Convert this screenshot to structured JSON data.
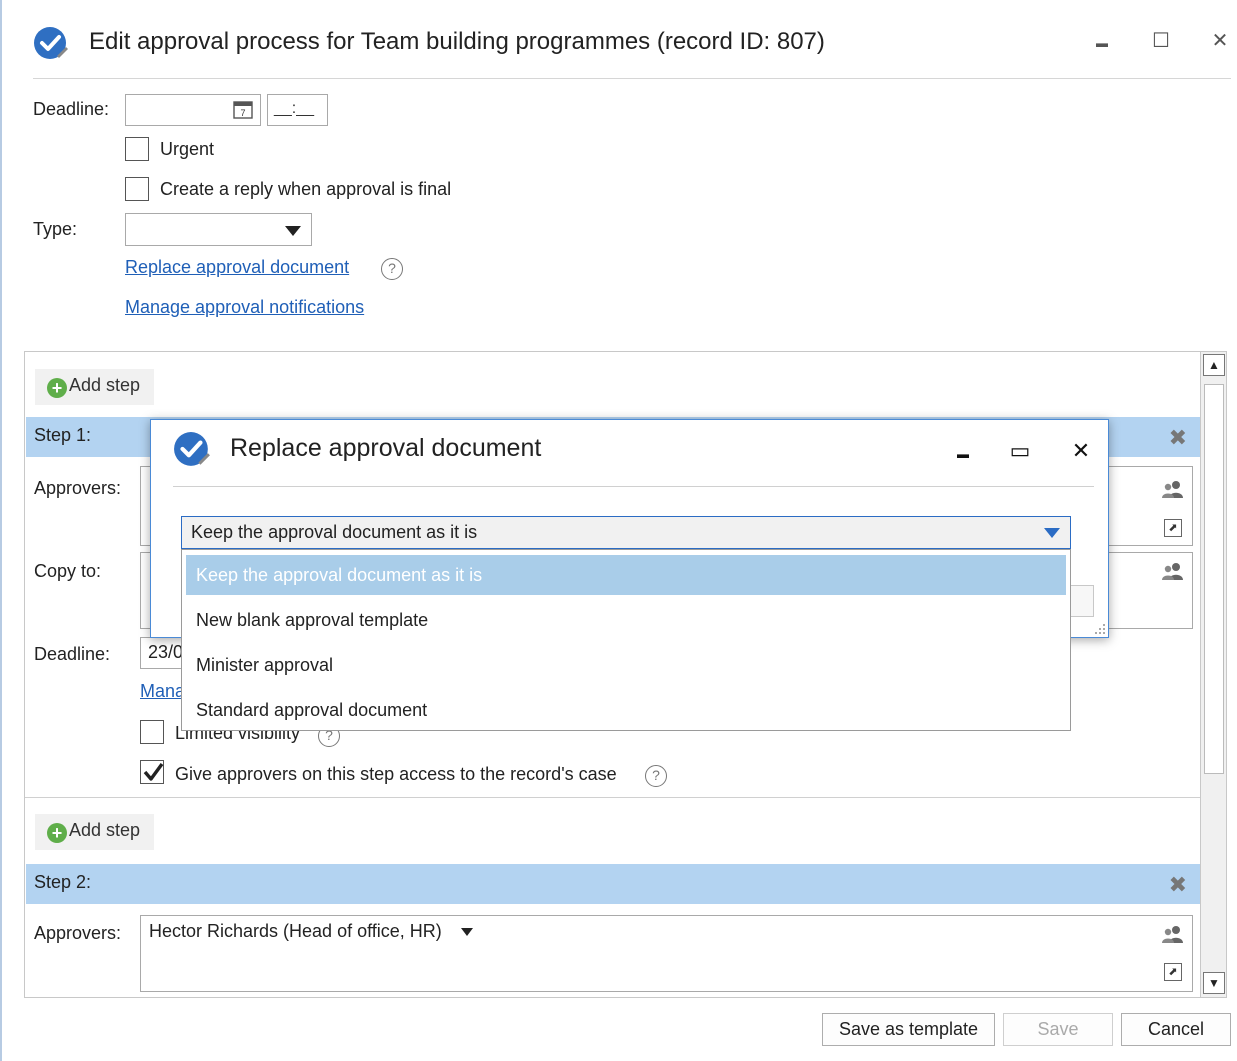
{
  "window": {
    "title": "Edit approval process for Team building programmes (record ID: 807)",
    "minimize_glyph": "▬",
    "maximize_glyph": "☐",
    "close_glyph": "✕"
  },
  "form": {
    "deadline_label": "Deadline:",
    "time_placeholder": "__:__",
    "urgent_label": "Urgent",
    "create_reply_label": "Create a reply when approval is final",
    "type_label": "Type:",
    "type_value": "",
    "replace_link": "Replace approval document",
    "manage_notifications_link": "Manage approval notifications",
    "help_glyph": "?"
  },
  "steps": {
    "add_step_label": "Add step",
    "step1": {
      "header": "Step 1:",
      "approvers_label": "Approvers:",
      "copy_to_label": "Copy to:",
      "deadline_label": "Deadline:",
      "deadline_value": "23/0",
      "manage_link_partial": "Mana",
      "limited_visibility_label": "Limited visibility",
      "limited_visibility_checked": false,
      "give_access_label": "Give approvers on this step access to the record's case",
      "give_access_checked": true
    },
    "step2": {
      "header": "Step 2:",
      "approvers_label": "Approvers:",
      "approver_value": "Hector Richards (Head of office, HR)"
    }
  },
  "dialog": {
    "title": "Replace approval document",
    "minimize_glyph": "▬",
    "maximize_glyph": "▭",
    "close_glyph": "✕",
    "selected_value": "Keep the approval document as it is",
    "options": [
      "Keep the approval document as it is",
      "New blank approval template",
      "Minister approval",
      "Standard approval document"
    ],
    "selected_index": 0
  },
  "buttons": {
    "save_as_template": "Save as template",
    "save": "Save",
    "cancel": "Cancel"
  },
  "colors": {
    "accent": "#2b6cc4",
    "link": "#1f5fb7",
    "step_header": "#b3d3f1",
    "selection": "#a9cde9",
    "add_green": "#5fae4a"
  }
}
